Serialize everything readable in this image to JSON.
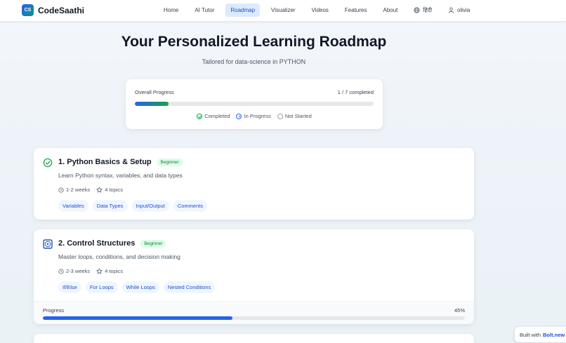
{
  "brand": {
    "badge": "CS",
    "name": "CodeSaathi"
  },
  "nav": {
    "links": [
      {
        "label": "Home"
      },
      {
        "label": "AI Tutor"
      },
      {
        "label": "Roadmap",
        "active": true
      },
      {
        "label": "Visualizer"
      },
      {
        "label": "Videos"
      },
      {
        "label": "Features"
      },
      {
        "label": "About"
      }
    ],
    "language": "हिंदी",
    "user": "olivia"
  },
  "header": {
    "title": "Your Personalized Learning Roadmap",
    "subtitle": "Tailored for data-science in PYTHON"
  },
  "overall": {
    "label": "Overall Progress",
    "count_text": "1 / 7 completed",
    "fraction": 0.14,
    "legend": {
      "completed": "Completed",
      "in_progress": "In Progress",
      "not_started": "Not Started"
    }
  },
  "modules": [
    {
      "title": "1. Python Basics & Setup",
      "level": "Beginner",
      "status": "completed",
      "description": "Learn Python syntax, variables, and data types",
      "duration": "1-2 weeks",
      "topics_count": "4 topics",
      "tags": [
        "Variables",
        "Data Types",
        "Input/Output",
        "Comments"
      ]
    },
    {
      "title": "2. Control Structures",
      "level": "Beginner",
      "status": "in-progress",
      "description": "Master loops, conditions, and decision making",
      "duration": "2-3 weeks",
      "topics_count": "4 topics",
      "tags": [
        "If/Else",
        "For Loops",
        "While Loops",
        "Nested Conditions"
      ],
      "progress_label": "Progress",
      "progress_text": "45%",
      "progress_fraction": 0.45
    }
  ],
  "footer_badge": {
    "prefix": "Built with",
    "link": "Bolt.new"
  },
  "colors": {
    "accent": "#2563eb",
    "success": "#16a34a",
    "badge_bg": "#dcfce7",
    "tag_bg": "#eff6ff"
  },
  "icons": {
    "globe": "globe-icon",
    "user": "user-icon",
    "clock": "clock-icon",
    "star": "star-icon",
    "check_circle": "check-circle-icon",
    "play": "play-icon"
  }
}
